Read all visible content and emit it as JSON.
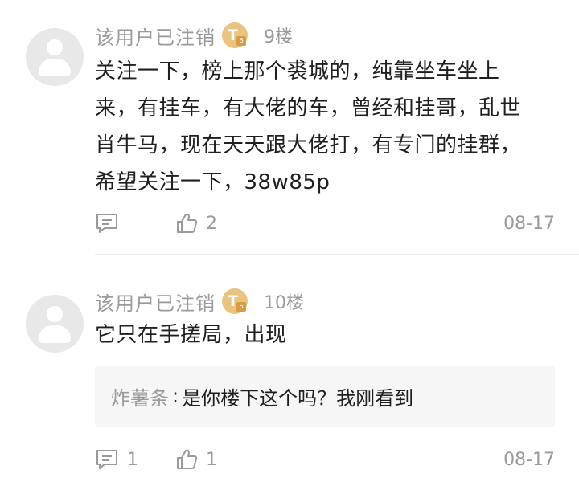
{
  "posts": [
    {
      "username": "该用户已注销",
      "badge_letter": "T",
      "badge_sub": "6",
      "floor": "9楼",
      "content": "关注一下，榜上那个裘城的，纯靠坐车坐上\n来，有挂车，有大佬的车，曾经和挂哥，乱世\n肖牛马，现在天天跟大佬打，有专门的挂群，\n希望关注一下，38w85p",
      "reply_count": "",
      "like_count": "2",
      "date": "08-17"
    },
    {
      "username": "该用户已注销",
      "badge_letter": "T",
      "badge_sub": "6",
      "floor": "10楼",
      "content": "它只在手搓局，出现",
      "quote": {
        "author": "炸薯条",
        "separator": ":",
        "text": "是你楼下这个吗？我刚看到"
      },
      "reply_count": "1",
      "like_count": "1",
      "date": "08-17"
    }
  ],
  "colors": {
    "meta_gray": "#9a9a9a",
    "text": "#1f1f1f",
    "badge_gold": "#e9c37f",
    "quote_bg": "#f6f6f6"
  },
  "icons": {
    "reply": "comment-bubble-icon",
    "like": "thumbs-up-icon",
    "avatar": "default-user-avatar"
  }
}
